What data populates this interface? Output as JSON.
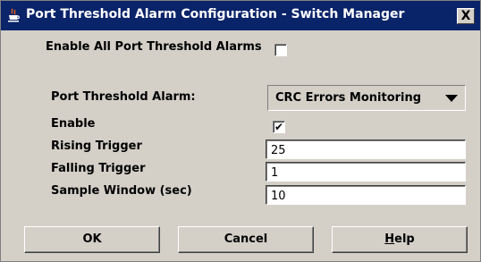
{
  "window": {
    "title": "Port Threshold Alarm Configuration - Switch Manager",
    "close_glyph": "X",
    "icon": "java-cup-icon"
  },
  "form": {
    "enable_all_label": "Enable All Port Threshold Alarms",
    "enable_all_checked": false,
    "alarm_label": "Port Threshold Alarm:",
    "alarm_selected": "CRC Errors Monitoring",
    "enable_label": "Enable",
    "enable_checked": true,
    "enable_mark": "✔",
    "rising_label": "Rising Trigger",
    "rising_value": "25",
    "falling_label": "Falling Trigger",
    "falling_value": "1",
    "sample_label": "Sample Window (sec)",
    "sample_value": "10"
  },
  "buttons": {
    "ok": "OK",
    "cancel": "Cancel",
    "help": "Help"
  },
  "colors": {
    "titlebar": "#0a246a",
    "dialog_bg": "#d4d0c8"
  }
}
